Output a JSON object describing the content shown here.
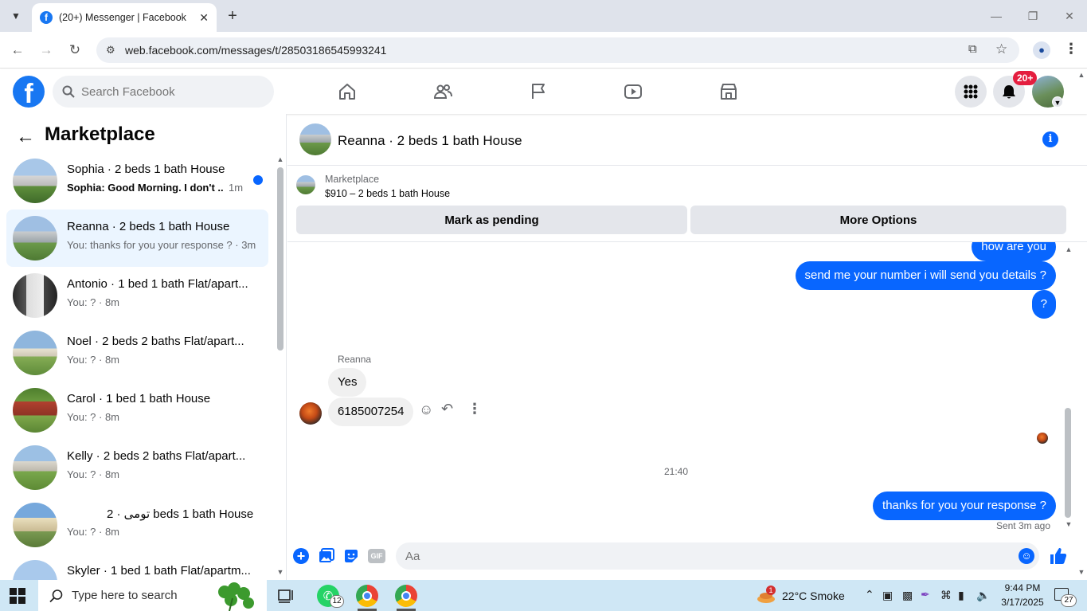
{
  "browser": {
    "tab_title": "(20+) Messenger | Facebook",
    "url": "web.facebook.com/messages/t/28503186545993241"
  },
  "fb_header": {
    "search_placeholder": "Search Facebook",
    "notification_badge": "20+"
  },
  "sidebar": {
    "title": "Marketplace",
    "conversations": [
      {
        "name": "Sophia · 2 beds 1 bath House",
        "preview": "Sophia: Good Morning. I don't ...",
        "time": "1m",
        "unread": true,
        "active": false
      },
      {
        "name": "Reanna · 2 beds 1 bath House",
        "preview": "You: thanks for you your response ? · 3m",
        "time": "",
        "unread": false,
        "active": true
      },
      {
        "name": "Antonio · 1 bed 1 bath Flat/apart...",
        "preview": "You: ? · 8m",
        "time": "",
        "unread": false,
        "active": false
      },
      {
        "name": "Noel · 2 beds 2 baths Flat/apart...",
        "preview": "You: ? · 8m",
        "time": "",
        "unread": false,
        "active": false
      },
      {
        "name": "Carol · 1 bed 1 bath House",
        "preview": "You: ? · 8m",
        "time": "",
        "unread": false,
        "active": false
      },
      {
        "name": "Kelly · 2 beds 2 baths Flat/apart...",
        "preview": "You: ? · 8m",
        "time": "",
        "unread": false,
        "active": false
      },
      {
        "name": "تومی · 2 beds 1 bath House",
        "preview": "You: ? · 8m",
        "time": "",
        "unread": false,
        "active": false
      },
      {
        "name": "Skyler · 1 bed 1 bath Flat/apartm...",
        "preview": "",
        "time": "",
        "unread": false,
        "active": false
      }
    ]
  },
  "chat": {
    "title": "Reanna · 2 beds 1 bath House",
    "listing_label": "Marketplace",
    "listing_price": "$910 – 2 beds 1 bath House",
    "btn_pending": "Mark as pending",
    "btn_more": "More Options",
    "messages": {
      "out_1": "how are you",
      "out_2": "send me your number i will send you details ?",
      "out_3": "?",
      "sender": "Reanna",
      "in_1": "Yes",
      "in_2": "6185007254",
      "timestamp": "21:40",
      "out_4": "thanks for you your response ?",
      "status": "Sent 3m ago"
    },
    "composer_placeholder": "Aa",
    "gif_label": "GIF"
  },
  "taskbar": {
    "search_text": "Type here to search",
    "whatsapp_badge": "12",
    "weather": "22°C  Smoke",
    "weather_badge": "1",
    "time": "9:44 PM",
    "date": "3/17/2025",
    "notif_count": "27"
  }
}
